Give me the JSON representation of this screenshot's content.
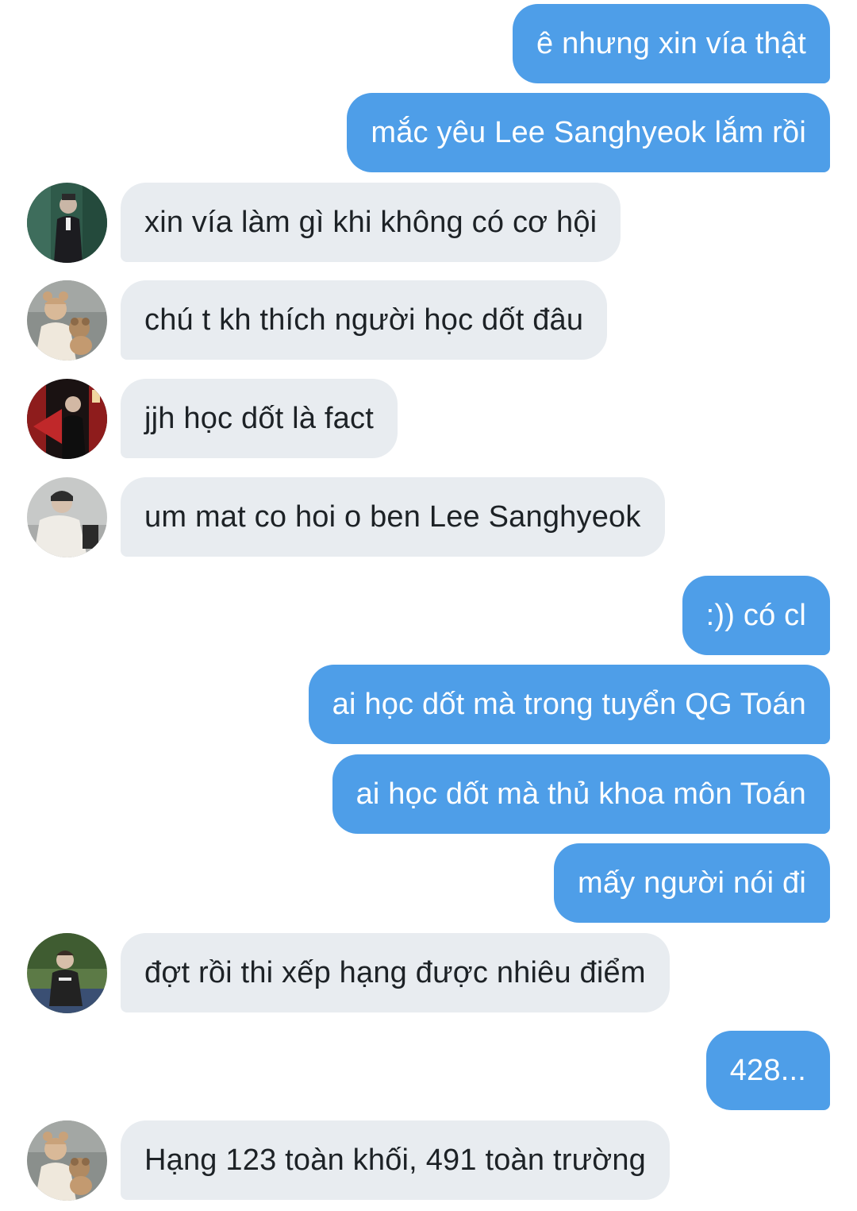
{
  "messages": [
    {
      "id": 1,
      "side": "out",
      "text": "ê nhưng xin vía thật"
    },
    {
      "id": 2,
      "side": "out",
      "text": "mắc yêu Lee Sanghyeok lắm rồi"
    },
    {
      "id": 3,
      "side": "in",
      "avatar": "avatar-suit-man",
      "text": "xin vía làm gì khi không có cơ hội"
    },
    {
      "id": 4,
      "side": "in",
      "avatar": "avatar-bear-hat",
      "text": "chú t kh thích người học dốt đâu"
    },
    {
      "id": 5,
      "side": "in",
      "avatar": "avatar-red-fan",
      "text": "jjh học dốt là fact"
    },
    {
      "id": 6,
      "side": "in",
      "avatar": "avatar-white-jacket",
      "text": "um mat co hoi o ben Lee Sanghyeok"
    },
    {
      "id": 7,
      "side": "out",
      "text": ":)) có cl"
    },
    {
      "id": 8,
      "side": "out",
      "text": "ai học dốt mà trong tuyển QG Toán"
    },
    {
      "id": 9,
      "side": "out",
      "text": "ai học dốt mà thủ khoa môn Toán"
    },
    {
      "id": 10,
      "side": "out",
      "text": "mấy người nói đi"
    },
    {
      "id": 11,
      "side": "in",
      "avatar": "avatar-outdoor-crouch",
      "text": "đợt rồi thi xếp hạng được nhiêu điểm"
    },
    {
      "id": 12,
      "side": "out",
      "text": "428..."
    },
    {
      "id": 13,
      "side": "in",
      "avatar": "avatar-bear-hat",
      "text": "Hạng 123 toàn khối, 491 toàn trường"
    }
  ],
  "colors": {
    "outgoing_bubble": "#4e9ee8",
    "incoming_bubble": "#e8ecf0",
    "background": "#ffffff"
  }
}
